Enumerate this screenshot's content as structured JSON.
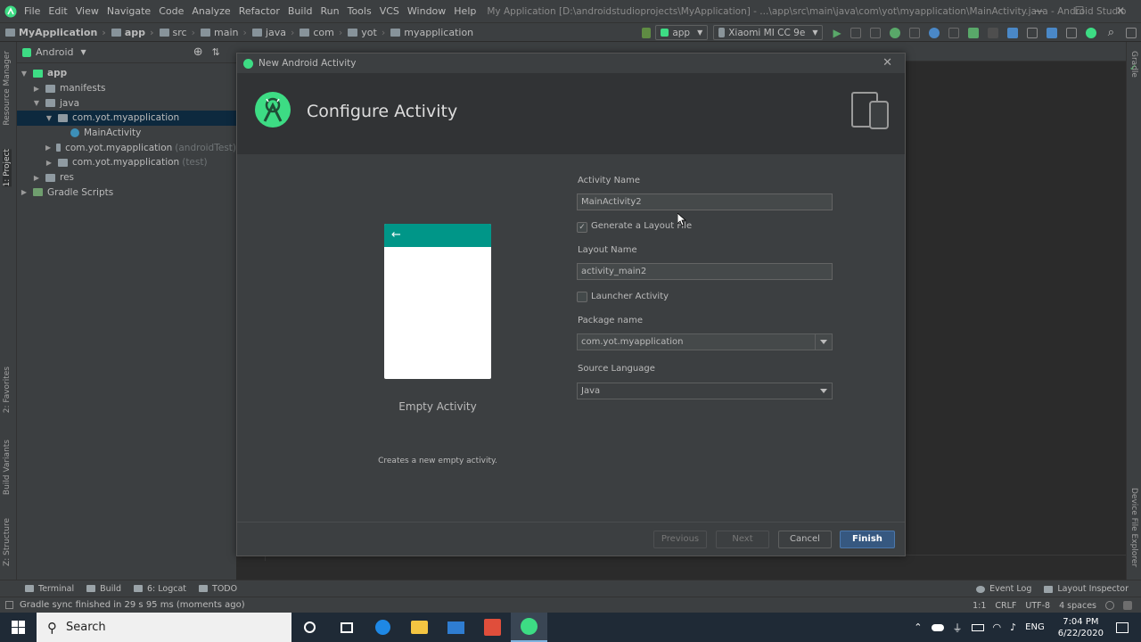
{
  "menubar": {
    "items": [
      "File",
      "Edit",
      "View",
      "Navigate",
      "Code",
      "Analyze",
      "Refactor",
      "Build",
      "Run",
      "Tools",
      "VCS",
      "Window",
      "Help"
    ],
    "window_title": "My Application [D:\\androidstudioprojects\\MyApplication] - ...\\app\\src\\main\\java\\com\\yot\\myapplication\\MainActivity.java - Android Studio",
    "minimize": "—",
    "maximize": "☐",
    "close": "✕"
  },
  "navbar": {
    "crumbs": [
      "MyApplication",
      "app",
      "src",
      "main",
      "java",
      "com",
      "yot",
      "myapplication"
    ],
    "run_config": "app",
    "device": "Xiaomi MI CC 9e"
  },
  "leftstripe": {
    "tabs": [
      "Resource Manager",
      "1: Project",
      "2: Favorites",
      "Build Variants",
      "Z: Structure"
    ]
  },
  "rightstripe": {
    "tabs": [
      "Gradle",
      "Device File Explorer"
    ]
  },
  "project": {
    "view_label": "Android",
    "tree": [
      {
        "label": "app",
        "suffix": ""
      },
      {
        "label": "manifests",
        "suffix": ""
      },
      {
        "label": "java",
        "suffix": ""
      },
      {
        "label": "com.yot.myapplication",
        "suffix": ""
      },
      {
        "label": "MainActivity",
        "suffix": ""
      },
      {
        "label": "com.yot.myapplication",
        "suffix": "(androidTest)"
      },
      {
        "label": "com.yot.myapplication",
        "suffix": "(test)"
      },
      {
        "label": "res",
        "suffix": ""
      },
      {
        "label": "Gradle Scripts",
        "suffix": ""
      }
    ]
  },
  "dialog": {
    "title": "New Android Activity",
    "heading": "Configure Activity",
    "preview_name": "Empty Activity",
    "preview_description": "Creates a new empty activity.",
    "activity_name_label": "Activity Name",
    "activity_name_value": "MainActivity2",
    "generate_layout_label": "Generate a Layout File",
    "generate_layout_checked": true,
    "layout_name_label": "Layout Name",
    "layout_name_value": "activity_main2",
    "launcher_label": "Launcher Activity",
    "launcher_checked": false,
    "package_label": "Package name",
    "package_value": "com.yot.myapplication",
    "language_label": "Source Language",
    "language_value": "Java",
    "buttons": {
      "previous": "Previous",
      "next": "Next",
      "cancel": "Cancel",
      "finish": "Finish"
    },
    "check_mark": "✓",
    "back_arrow": "←"
  },
  "tooltabs": {
    "terminal": "Terminal",
    "build": "Build",
    "logcat": "6: Logcat",
    "todo": "TODO",
    "event_log": "Event Log",
    "layout_inspector": "Layout Inspector"
  },
  "statusbar": {
    "message": "Gradle sync finished in 29 s 95 ms (moments ago)",
    "position": "1:1",
    "line_sep": "CRLF",
    "encoding": "UTF-8",
    "indent": "4 spaces"
  },
  "taskbar": {
    "search_placeholder": "Search",
    "language": "ENG",
    "time": "7:04 PM",
    "date": "6/22/2020"
  },
  "colors": {
    "accent": "#365880",
    "preview_bar": "#009688",
    "android_green": "#3ddc84"
  }
}
